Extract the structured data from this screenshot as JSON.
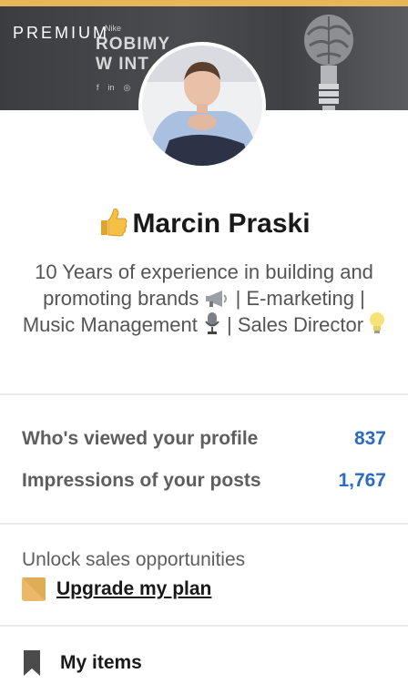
{
  "banner": {
    "premium_label": "PREMIUM",
    "brand_small": "Nike",
    "brand_line1": "ROBIMY",
    "brand_line2": "W INT",
    "social": [
      "f",
      "in",
      "◎"
    ]
  },
  "profile": {
    "name": "Marcin Praski",
    "name_emoji": "thumbs-up-icon",
    "headline_parts": {
      "p1": "10 Years of experience in building and promoting brands",
      "p2": " | E-marketing | Music Management ",
      "p3": " | Sales Director "
    }
  },
  "stats": [
    {
      "label": "Who's viewed your profile",
      "value": "837"
    },
    {
      "label": "Impressions of your posts",
      "value": "1,767"
    }
  ],
  "upsell": {
    "text": "Unlock sales opportunities",
    "link": "Upgrade my plan"
  },
  "my_items": {
    "label": "My items"
  },
  "colors": {
    "accent_blue": "#2b6bc2",
    "premium_gold": "#e8b55a",
    "text_dark": "#191919",
    "text_muted": "#5e5e5e"
  }
}
